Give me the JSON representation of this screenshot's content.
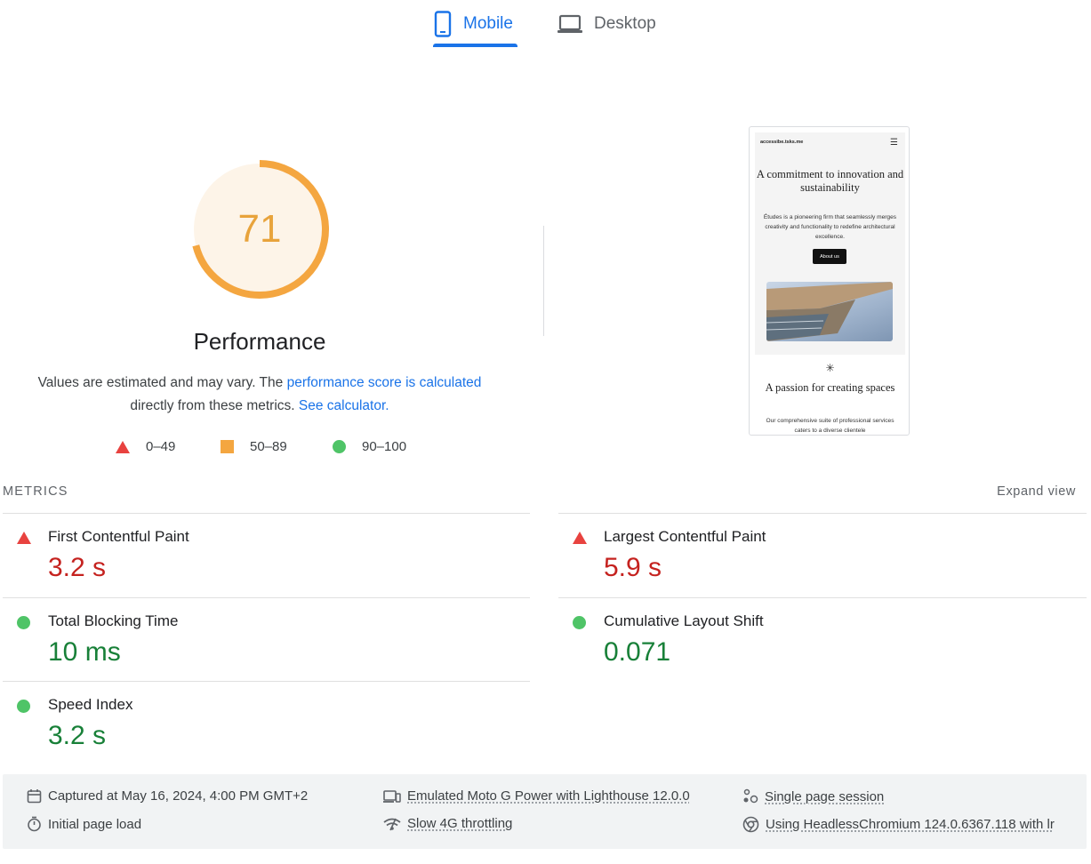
{
  "tabs": [
    {
      "label": "Mobile",
      "icon": "phone-icon",
      "active": true
    },
    {
      "label": "Desktop",
      "icon": "laptop-icon",
      "active": false
    }
  ],
  "performance": {
    "score": "71",
    "score_fraction": 0.71,
    "title": "Performance",
    "description_prefix": "Values are estimated and may vary. The ",
    "description_link": "performance score is calculated",
    "description_middle": "directly from these metrics. ",
    "calculator_link": "See calculator."
  },
  "legend": [
    {
      "range": "0–49",
      "icon": "red-triangle-icon"
    },
    {
      "range": "50–89",
      "icon": "orange-square-icon"
    },
    {
      "range": "90–100",
      "icon": "green-circle-icon"
    }
  ],
  "thumbnail": {
    "site_name": "accessibe.tsks.me",
    "heading": "A commitment to innovation and sustainability",
    "paragraph": "Études is a pioneering firm that seamlessly merges creativity and functionality to redefine architectural excellence.",
    "button": "About us",
    "star": "✳",
    "heading2": "A passion for creating spaces",
    "paragraph2": "Our comprehensive suite of professional services caters to a diverse clientele"
  },
  "metrics_header": {
    "label": "METRICS",
    "expand": "Expand view"
  },
  "metrics": [
    {
      "name": "First Contentful Paint",
      "value": "3.2 s",
      "status": "fail"
    },
    {
      "name": "Largest Contentful Paint",
      "value": "5.9 s",
      "status": "fail"
    },
    {
      "name": "Total Blocking Time",
      "value": "10 ms",
      "status": "pass"
    },
    {
      "name": "Cumulative Layout Shift",
      "value": "0.071",
      "status": "pass"
    },
    {
      "name": "Speed Index",
      "value": "3.2 s",
      "status": "pass"
    }
  ],
  "info": {
    "captured": "Captured at May 16, 2024, 4:00 PM GMT+2",
    "initial_load": "Initial page load",
    "emulated": "Emulated Moto G Power with Lighthouse 12.0.0",
    "throttling": "Slow 4G throttling",
    "session": "Single page session",
    "browser": "Using HeadlessChromium 124.0.6367.118 with lr"
  },
  "colors": {
    "accent": "#1a73e8",
    "average": "#e8a33b",
    "fail": "#c5221f",
    "pass": "#188038"
  }
}
